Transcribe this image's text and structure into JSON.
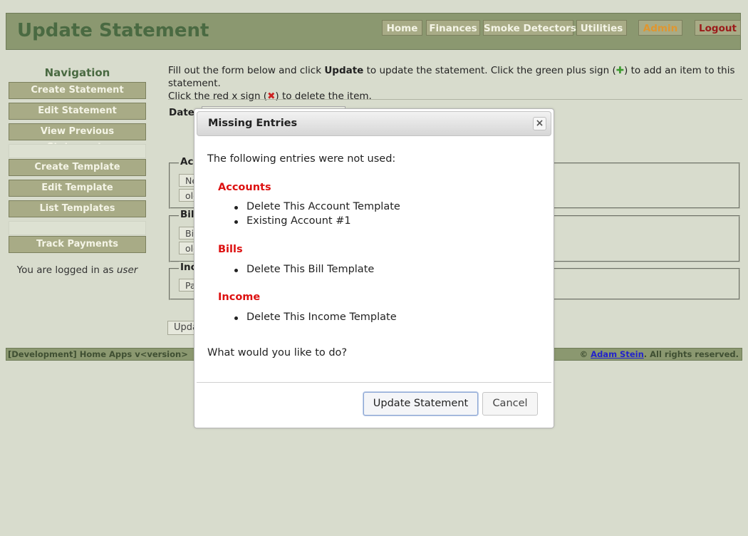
{
  "header": {
    "title": "Update Statement",
    "nav": [
      {
        "label": "Home"
      },
      {
        "label": "Finances"
      },
      {
        "label": "Smoke Detectors"
      },
      {
        "label": "Utilities"
      },
      {
        "label": "Admin"
      },
      {
        "label": "Logout"
      }
    ]
  },
  "sidebar": {
    "title": "Navigation",
    "items": [
      {
        "label": "Create Statement"
      },
      {
        "label": "Edit Statement"
      },
      {
        "label": "View Previous Statements"
      },
      {
        "label": "Create Template"
      },
      {
        "label": "Edit Template"
      },
      {
        "label": "List Templates"
      },
      {
        "label": "Track Payments"
      }
    ],
    "login_prefix": "You are logged in as ",
    "login_user": "user"
  },
  "main": {
    "instr_1": "Fill out the form below and click ",
    "instr_bold": "Update",
    "instr_2": " to update the statement. Click the green plus sign (",
    "plus_glyph": "✚",
    "instr_3": ") to add an item to this statement.",
    "instr_4": "Click the red x sign (",
    "x_glyph": "✖",
    "instr_5": ") to delete the item.",
    "date_label": "Date:",
    "sections": [
      {
        "legend": "Acc",
        "chips": [
          "Ne",
          "old"
        ]
      },
      {
        "legend": "Bill",
        "chips": [
          "Bil",
          "old"
        ]
      },
      {
        "legend": "Inc",
        "chips": [
          "Pa"
        ]
      }
    ],
    "update_button": "Upda"
  },
  "footer": {
    "left": "[Development] Home Apps v<version>",
    "copyright": "© ",
    "author": "Adam Stein",
    "rights": ". All rights reserved."
  },
  "modal": {
    "title": "Missing Entries",
    "close_glyph": "×",
    "intro": "The following entries were not used:",
    "groups": [
      {
        "heading": "Accounts",
        "items": [
          "Delete This Account Template",
          "Existing Account #1"
        ]
      },
      {
        "heading": "Bills",
        "items": [
          "Delete This Bill Template"
        ]
      },
      {
        "heading": "Income",
        "items": [
          "Delete This Income Template"
        ]
      }
    ],
    "question": "What would you like to do?",
    "update_label": "Update Statement",
    "cancel_label": "Cancel"
  }
}
